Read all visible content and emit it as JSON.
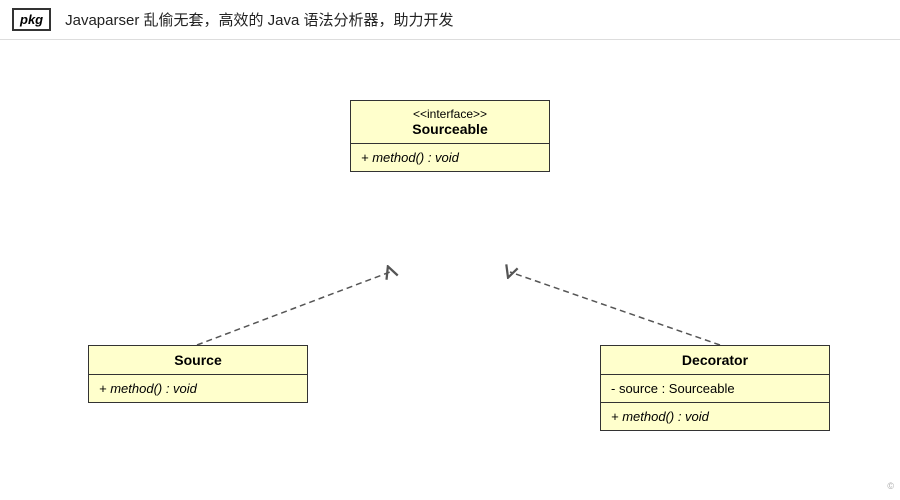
{
  "header": {
    "badge": "pkg",
    "title": "Javaparser 乱偷无套，高效的 Java 语法分析器，助力开发"
  },
  "diagram": {
    "sourceable": {
      "stereotype": "<<interface>>",
      "name": "Sourceable",
      "method": "+ method() : void"
    },
    "source": {
      "name": "Source",
      "method": "+ method() : void"
    },
    "decorator": {
      "name": "Decorator",
      "field": "- source : Sourceable",
      "method": "+ method() : void"
    }
  },
  "watermark": "©"
}
